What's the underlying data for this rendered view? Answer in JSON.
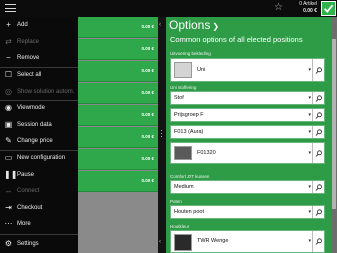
{
  "topbar": {
    "artikel_count": "0 Artikel",
    "total_price": "0.00 €"
  },
  "menu": [
    {
      "icon": "plus-icon",
      "label": "Add",
      "enabled": true
    },
    {
      "icon": "replace-icon",
      "label": "Replace",
      "enabled": false
    },
    {
      "icon": "minus-icon",
      "label": "Remove",
      "enabled": true
    },
    {
      "icon": "select-all-icon",
      "label": "Select all",
      "enabled": true
    },
    {
      "icon": "eye-off-icon",
      "label": "Show solution autom.",
      "enabled": false
    },
    {
      "icon": "eye-icon",
      "label": "Viewmode",
      "enabled": true
    },
    {
      "icon": "session-icon",
      "label": "Session data",
      "enabled": true
    },
    {
      "icon": "price-tag-icon",
      "label": "Change price",
      "enabled": true
    },
    {
      "icon": "new-config-icon",
      "label": "New configuration",
      "enabled": true
    },
    {
      "icon": "pause-icon",
      "label": "Pause",
      "enabled": true
    },
    {
      "icon": "connect-icon",
      "label": "Connect",
      "enabled": false
    },
    {
      "icon": "checkout-icon",
      "label": "Checkout",
      "enabled": true
    },
    {
      "icon": "more-icon",
      "label": "More",
      "enabled": true
    },
    {
      "icon": "gear-icon",
      "label": "Settings",
      "enabled": true
    }
  ],
  "price_rows": [
    "0.00 €",
    "0.00 €",
    "0.00 €",
    "0.00 €",
    "0.00 €",
    "0.00 €",
    "0.00 €",
    "0.00 €"
  ],
  "options": {
    "title": "Options",
    "subtitle": "Common options of all elected positions",
    "fields": {
      "uitvoering_label": "Uitvoering bekleding",
      "uitvoering_value": "Uni",
      "stoffering_label": "Uni stoffering",
      "stof_value": "Stof",
      "prijsgroep_value": "Prijsgroep F",
      "kleur_value": "F013 (Aura)",
      "swatch_value": "F01320",
      "comfort_label": "Comfort ZIT kussen",
      "comfort_value": "Medium",
      "poten_label": "Poten",
      "poten_value": "Houten poot",
      "houtkleur_label": "Houtkleur",
      "houtkleur_value": "TWR Wenge"
    }
  }
}
